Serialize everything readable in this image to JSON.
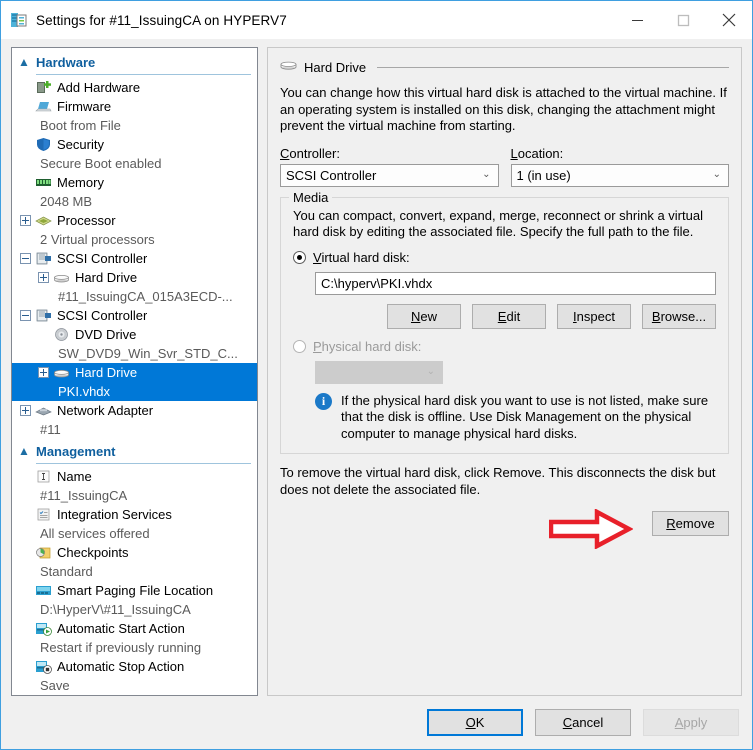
{
  "window": {
    "title": "Settings for #11_IssuingCA on HYPERV7",
    "icon": "settings-vm-icon",
    "minimize_label": "—",
    "maximize_label": "□",
    "close_label": "✕",
    "accent_color": "#3f9fe0",
    "selection_color": "#0078d7"
  },
  "sidebar": {
    "groups": [
      {
        "title": "Hardware",
        "chevron": "▲",
        "items": [
          {
            "label": "Add Hardware",
            "sub": null,
            "icon": "add-hardware-icon",
            "expander": null,
            "indent": 0,
            "selected": false
          },
          {
            "label": "Firmware",
            "sub": "Boot from File",
            "icon": "firmware-icon",
            "expander": null,
            "indent": 0,
            "selected": false
          },
          {
            "label": "Security",
            "sub": "Secure Boot enabled",
            "icon": "security-shield-icon",
            "expander": null,
            "indent": 0,
            "selected": false
          },
          {
            "label": "Memory",
            "sub": "2048 MB",
            "icon": "memory-icon",
            "expander": null,
            "indent": 0,
            "selected": false
          },
          {
            "label": "Processor",
            "sub": "2 Virtual processors",
            "icon": "processor-icon",
            "expander": "plus",
            "indent": 0,
            "selected": false
          },
          {
            "label": "SCSI Controller",
            "sub": null,
            "icon": "scsi-controller-icon",
            "expander": "minus",
            "indent": 0,
            "selected": false
          },
          {
            "label": "Hard Drive",
            "sub": "#11_IssuingCA_015A3ECD-...",
            "icon": "hard-drive-icon",
            "expander": "plus",
            "indent": 1,
            "selected": false
          },
          {
            "label": "SCSI Controller",
            "sub": null,
            "icon": "scsi-controller-icon",
            "expander": "minus",
            "indent": 0,
            "selected": false
          },
          {
            "label": "DVD Drive",
            "sub": "SW_DVD9_Win_Svr_STD_C...",
            "icon": "dvd-drive-icon",
            "expander": null,
            "indent": 1,
            "selected": false
          },
          {
            "label": "Hard Drive",
            "sub": "PKI.vhdx",
            "icon": "hard-drive-icon",
            "expander": "plus",
            "indent": 1,
            "selected": true
          },
          {
            "label": "Network Adapter",
            "sub": "#11",
            "icon": "network-adapter-icon",
            "expander": "plus",
            "indent": 0,
            "selected": false
          }
        ]
      },
      {
        "title": "Management",
        "chevron": "▲",
        "items": [
          {
            "label": "Name",
            "sub": "#11_IssuingCA",
            "icon": "name-icon",
            "expander": null,
            "indent": 0,
            "selected": false
          },
          {
            "label": "Integration Services",
            "sub": "All services offered",
            "icon": "integration-services-icon",
            "expander": null,
            "indent": 0,
            "selected": false
          },
          {
            "label": "Checkpoints",
            "sub": "Standard",
            "icon": "checkpoints-icon",
            "expander": null,
            "indent": 0,
            "selected": false
          },
          {
            "label": "Smart Paging File Location",
            "sub": "D:\\HyperV\\#11_IssuingCA",
            "icon": "smart-paging-icon",
            "expander": null,
            "indent": 0,
            "selected": false
          },
          {
            "label": "Automatic Start Action",
            "sub": "Restart if previously running",
            "icon": "auto-start-icon",
            "expander": null,
            "indent": 0,
            "selected": false
          },
          {
            "label": "Automatic Stop Action",
            "sub": "Save",
            "icon": "auto-stop-icon",
            "expander": null,
            "indent": 0,
            "selected": false
          }
        ]
      }
    ]
  },
  "panel": {
    "header_title": "Hard Drive",
    "header_icon": "hard-drive-icon",
    "description": "You can change how this virtual hard disk is attached to the virtual machine. If an operating system is installed on this disk, changing the attachment might prevent the virtual machine from starting.",
    "controller": {
      "label": "Controller:",
      "value": "SCSI Controller",
      "chevron": "⌄"
    },
    "location": {
      "label": "Location:",
      "value": "1 (in use)",
      "chevron": "⌄"
    },
    "media": {
      "legend": "Media",
      "description": "You can compact, convert, expand, merge, reconnect or shrink a virtual hard disk by editing the associated file. Specify the full path to the file.",
      "virtual_radio_label": "Virtual hard disk:",
      "virtual_radio_selected": true,
      "vhd_path": "C:\\hyperv\\PKI.vhdx",
      "buttons": [
        {
          "label": "New",
          "mnemonic": "N",
          "disabled": false
        },
        {
          "label": "Edit",
          "mnemonic": "E",
          "disabled": false
        },
        {
          "label": "Inspect",
          "mnemonic": "I",
          "disabled": false
        },
        {
          "label": "Browse...",
          "mnemonic": "B",
          "disabled": false
        }
      ],
      "physical_radio_label": "Physical hard disk:",
      "physical_radio_selected": false,
      "physical_combo_value": "",
      "physical_combo_chevron": "⌄",
      "info_icon": "info-icon",
      "info_text": "If the physical hard disk you want to use is not listed, make sure that the disk is offline. Use Disk Management on the physical computer to manage physical hard disks."
    },
    "remove_note": "To remove the virtual hard disk, click Remove. This disconnects the disk but does not delete the associated file.",
    "remove_button": {
      "label": "Remove",
      "mnemonic": "R"
    },
    "annotation": {
      "shape": "red-arrow-right",
      "color": "#e8202a"
    }
  },
  "footer": {
    "buttons": [
      {
        "label": "OK",
        "mnemonic": "O",
        "default": true,
        "disabled": false
      },
      {
        "label": "Cancel",
        "mnemonic": "C",
        "default": false,
        "disabled": false
      },
      {
        "label": "Apply",
        "mnemonic": "A",
        "default": false,
        "disabled": true
      }
    ]
  }
}
